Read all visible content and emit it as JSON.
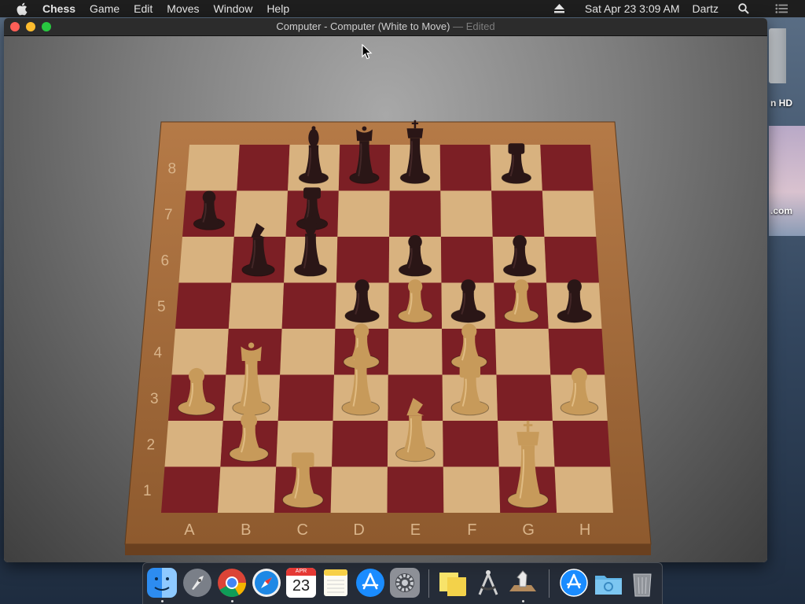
{
  "menubar": {
    "app_name": "Chess",
    "menus": [
      "Game",
      "Edit",
      "Moves",
      "Window",
      "Help"
    ],
    "datetime": "Sat Apr 23  3:09 AM",
    "user": "Dartz"
  },
  "window": {
    "title": "Computer - Computer   (White to Move)",
    "status": " — Edited"
  },
  "board": {
    "files": [
      "A",
      "B",
      "C",
      "D",
      "E",
      "F",
      "G",
      "H"
    ],
    "ranks": [
      "8",
      "7",
      "6",
      "5",
      "4",
      "3",
      "2",
      "1"
    ],
    "light_square": "#d8b27f",
    "dark_square": "#7c1f25",
    "frame": "#a0683a",
    "white_piece": "#c79a5a",
    "black_piece": "#2a1616",
    "pieces": [
      {
        "square": "c8",
        "type": "bishop",
        "color": "black"
      },
      {
        "square": "d8",
        "type": "queen",
        "color": "black"
      },
      {
        "square": "e8",
        "type": "king",
        "color": "black"
      },
      {
        "square": "g8",
        "type": "rook",
        "color": "black"
      },
      {
        "square": "a7",
        "type": "pawn",
        "color": "black"
      },
      {
        "square": "c7",
        "type": "rook",
        "color": "black"
      },
      {
        "square": "b6",
        "type": "knight",
        "color": "black"
      },
      {
        "square": "c6",
        "type": "bishop",
        "color": "black"
      },
      {
        "square": "e6",
        "type": "pawn",
        "color": "black"
      },
      {
        "square": "g6",
        "type": "pawn",
        "color": "black"
      },
      {
        "square": "d5",
        "type": "pawn",
        "color": "black"
      },
      {
        "square": "f5",
        "type": "pawn",
        "color": "black"
      },
      {
        "square": "h5",
        "type": "pawn",
        "color": "black"
      },
      {
        "square": "e5",
        "type": "pawn",
        "color": "white"
      },
      {
        "square": "g5",
        "type": "pawn",
        "color": "white"
      },
      {
        "square": "d4",
        "type": "pawn",
        "color": "white"
      },
      {
        "square": "f4",
        "type": "pawn",
        "color": "white"
      },
      {
        "square": "a3",
        "type": "pawn",
        "color": "white"
      },
      {
        "square": "b3",
        "type": "queen",
        "color": "white"
      },
      {
        "square": "d3",
        "type": "bishop",
        "color": "white"
      },
      {
        "square": "f3",
        "type": "rook",
        "color": "white"
      },
      {
        "square": "h3",
        "type": "pawn",
        "color": "white"
      },
      {
        "square": "b2",
        "type": "pawn",
        "color": "white"
      },
      {
        "square": "e2",
        "type": "knight",
        "color": "white"
      },
      {
        "square": "g1",
        "type": "king",
        "color": "white"
      },
      {
        "square": "c1",
        "type": "rook",
        "color": "white"
      }
    ]
  },
  "desktop": {
    "disk_label": "n HD",
    "site_label": ".com"
  },
  "dock": {
    "calendar_month": "APR",
    "calendar_day": "23",
    "items": [
      "finder-icon",
      "launchpad-icon",
      "chrome-icon",
      "safari-icon",
      "calendar-icon",
      "notes-icon",
      "app-store-icon",
      "system-preferences-icon",
      "stickies-icon",
      "instruments-icon",
      "chess-icon",
      "app-store-downloads-icon",
      "folder-icon",
      "trash-icon"
    ]
  }
}
